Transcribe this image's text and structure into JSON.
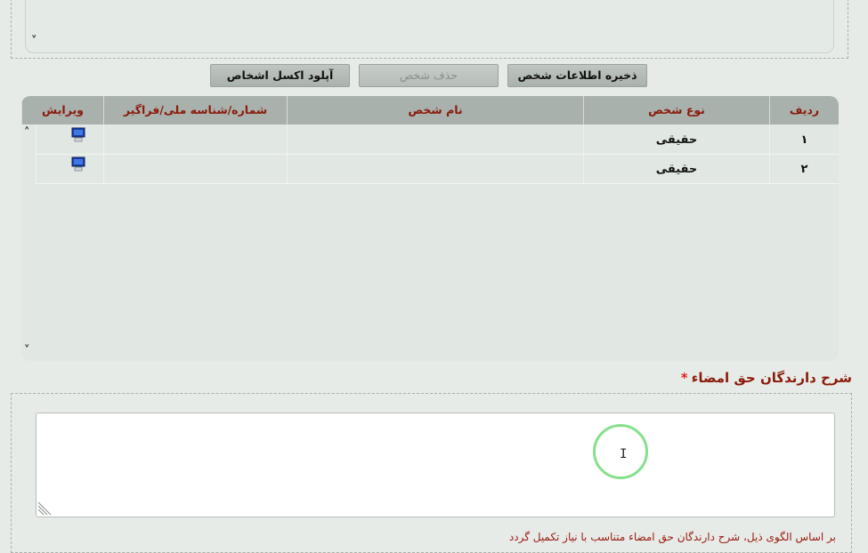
{
  "buttons": {
    "save_person": "ذخیره اطلاعات شخص",
    "delete_person": "حذف شخص",
    "upload_excel": "آپلود اکسل اشخاص"
  },
  "grid": {
    "columns": {
      "row_no": "ردیف",
      "person_type": "نوع شخص",
      "person_name": "نام شخص",
      "national_id": "شماره/شناسه ملی/فراگیر",
      "edit": "ویرایش"
    },
    "rows": [
      {
        "row_no": "۱",
        "person_type": "حقیقی",
        "person_name": "",
        "national_id": ""
      },
      {
        "row_no": "۲",
        "person_type": "حقیقی",
        "person_name": "",
        "national_id": ""
      }
    ]
  },
  "signatories": {
    "label": "شرح دارندگان حق امضاء",
    "required_mark": "*",
    "value": "",
    "hint": "بر اساس الگوی ذیل، شرح دارندگان حق امضاء متناسب با نیاز تکمیل گردد"
  },
  "colors": {
    "label_red": "#8a1a0a",
    "required_red": "#e0221a",
    "header_gray": "#a9b1ac"
  },
  "icons": {
    "scroll_up": "˄",
    "scroll_down": "˅",
    "text_cursor": "I"
  }
}
